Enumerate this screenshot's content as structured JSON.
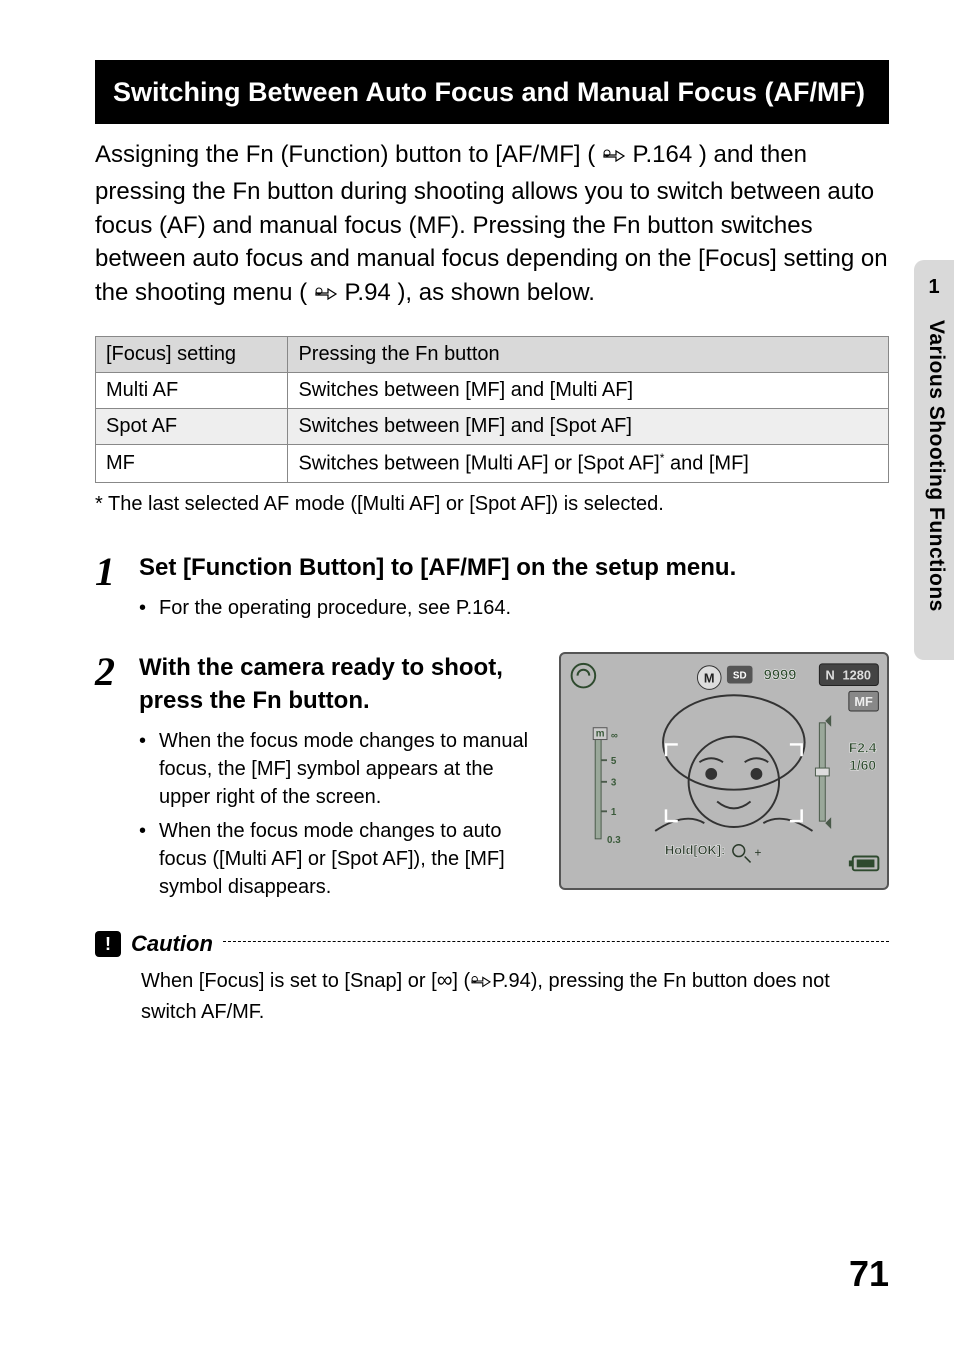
{
  "heading": "Switching Between Auto Focus and Manual Focus (AF/MF)",
  "intro": {
    "seg1": "Assigning the Fn (Function) button to [AF/MF] (",
    "ref1": "P.164",
    "seg2": ") and then pressing the Fn button during shooting allows you to switch between auto focus (AF) and manual focus (MF). Pressing the Fn button switches between auto focus and manual focus depending on the [Focus] setting on the shooting menu (",
    "ref2": "P.94",
    "seg3": "), as shown below."
  },
  "table": {
    "headers": [
      "[Focus] setting",
      "Pressing the Fn button"
    ],
    "rows": [
      {
        "setting": "Multi AF",
        "effect": "Switches between [MF] and [Multi AF]"
      },
      {
        "setting": "Spot AF",
        "effect": "Switches between [MF] and [Spot AF]"
      },
      {
        "setting": "MF",
        "effect_pre": "Switches between [Multi AF] or [Spot AF]",
        "sup": "*",
        "effect_post": " and [MF]"
      }
    ]
  },
  "footnote": "*  The last selected AF mode ([Multi AF] or [Spot AF]) is selected.",
  "steps": {
    "s1": {
      "num": "1",
      "title": "Set [Function Button] to [AF/MF] on the setup menu.",
      "b1": "For the operating procedure, see P.164."
    },
    "s2": {
      "num": "2",
      "title": "With the camera ready to shoot, press the Fn button.",
      "b1": "When the focus mode changes to manual focus, the [MF] symbol appears at the upper right of the screen.",
      "b2": "When the focus mode changes to auto focus ([Multi AF] or [Spot AF]), the [MF] symbol disappears."
    }
  },
  "lcd": {
    "sd": "SD",
    "shots": "9999",
    "n": "N",
    "size": "1280",
    "mf": "MF",
    "ap": "F2.4",
    "sh": "1/60",
    "m_inf": "∞",
    "m_5": "5",
    "m_3": "3",
    "m_1": "1",
    "m_03": "0.3",
    "hold": "Hold[OK]:",
    "m_label": "m",
    "mode": "M"
  },
  "caution": {
    "label": "Caution",
    "body_pre": "When [Focus] is set to [Snap] or [",
    "inf": "∞",
    "body_mid": "] (",
    "ref": "P.94",
    "body_post": "), pressing the Fn button does not switch AF/MF."
  },
  "sidebar": {
    "num": "1",
    "label": "Various Shooting Functions"
  },
  "page_number": "71"
}
